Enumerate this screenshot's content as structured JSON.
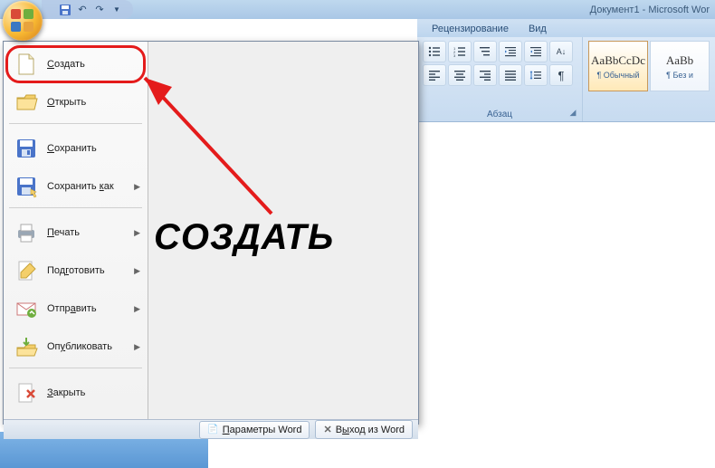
{
  "window": {
    "title": "Документ1 - Microsoft Wor"
  },
  "qat": {
    "save": "💾",
    "undo": "↶",
    "redo": "↷"
  },
  "tabs": {
    "review": "Рецензирование",
    "view": "Вид"
  },
  "ribbon": {
    "paragraph_label": "Абзац",
    "pilcrow": "¶",
    "sort": "А↓"
  },
  "styles": {
    "preview1": "AaBbCcDc",
    "name1": "¶ Обычный",
    "preview2": "AaBb",
    "name2": "¶ Без и"
  },
  "menu": {
    "create": "Создать",
    "open": "Открыть",
    "save": "Сохранить",
    "save_as": "Сохранить как",
    "print": "Печать",
    "prepare": "Подготовить",
    "send": "Отправить",
    "publish": "Опубликовать",
    "close": "Закрыть"
  },
  "footer": {
    "options": "Параметры Word",
    "exit": "Выход из Word"
  },
  "annotation": {
    "text": "СОЗДАТЬ"
  }
}
